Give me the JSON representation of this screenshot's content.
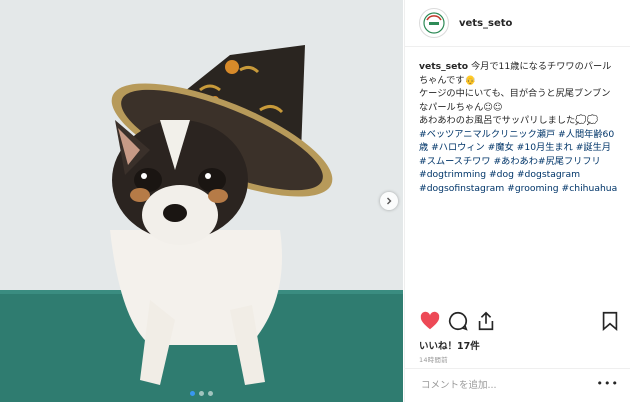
{
  "post": {
    "username": "vets_seto",
    "caption": {
      "user": "vets_seto",
      "text": " 今月で11歳になるチワワのパールちゃんです👴\nケージの中にいても、目が合うと尻尾ブンブンなパールちゃん☺︎☺︎\nあわあわのお風呂でサッパリしました💭💭\n",
      "hashtags": "#ベッツアニマルクリニック瀬戸 #人間年齢60歳 #ハロウィン #魔女 #10月生まれ #誕生月 #スムースチワワ #あわあわ#尻尾フリフリ#dogtrimming #dog #dogstagram #dogsofinstagram #grooming #chihuahua"
    },
    "likes": "いいね！17件",
    "time": "14時間前",
    "comment_placeholder": "コメントを追加...",
    "more": "•••",
    "icons": [
      "heart-icon",
      "comment-icon",
      "share-icon",
      "bookmark-icon",
      "next-arrow-icon"
    ],
    "colors": {
      "like": "#ed4956",
      "hashtag": "#003569",
      "active_dot": "#3897f0",
      "mat": "#2f7c70"
    },
    "carousel": {
      "total": 3,
      "current": 1
    }
  }
}
